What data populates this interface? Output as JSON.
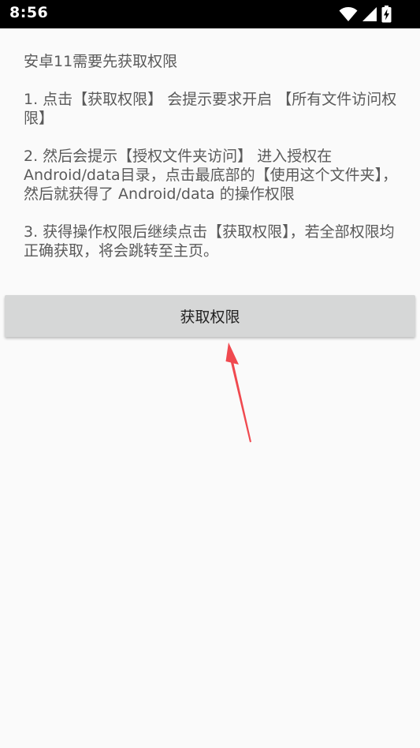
{
  "status_bar": {
    "time": "8:56",
    "icons": [
      "wifi-icon",
      "signal-icon",
      "battery-charging-icon"
    ]
  },
  "instructions": {
    "p0": "安卓11需要先获取权限",
    "p1": "1. 点击【获取权限】 会提示要求开启 【所有文件访问权限】",
    "p2": "2. 然后会提示【授权文件夹访问】 进入授权在Android/data目录，点击最底部的【使用这个文件夹】，然后就获得了 Android/data 的操作权限",
    "p3": "3. 获得操作权限后继续点击【获取权限】，若全部权限均正确获取，将会跳转至主页。"
  },
  "grant_button": {
    "label": "获取权限"
  },
  "colors": {
    "arrow": "#f0494f",
    "button_bg": "#d6d7d7",
    "status_bar_bg": "#000000"
  }
}
